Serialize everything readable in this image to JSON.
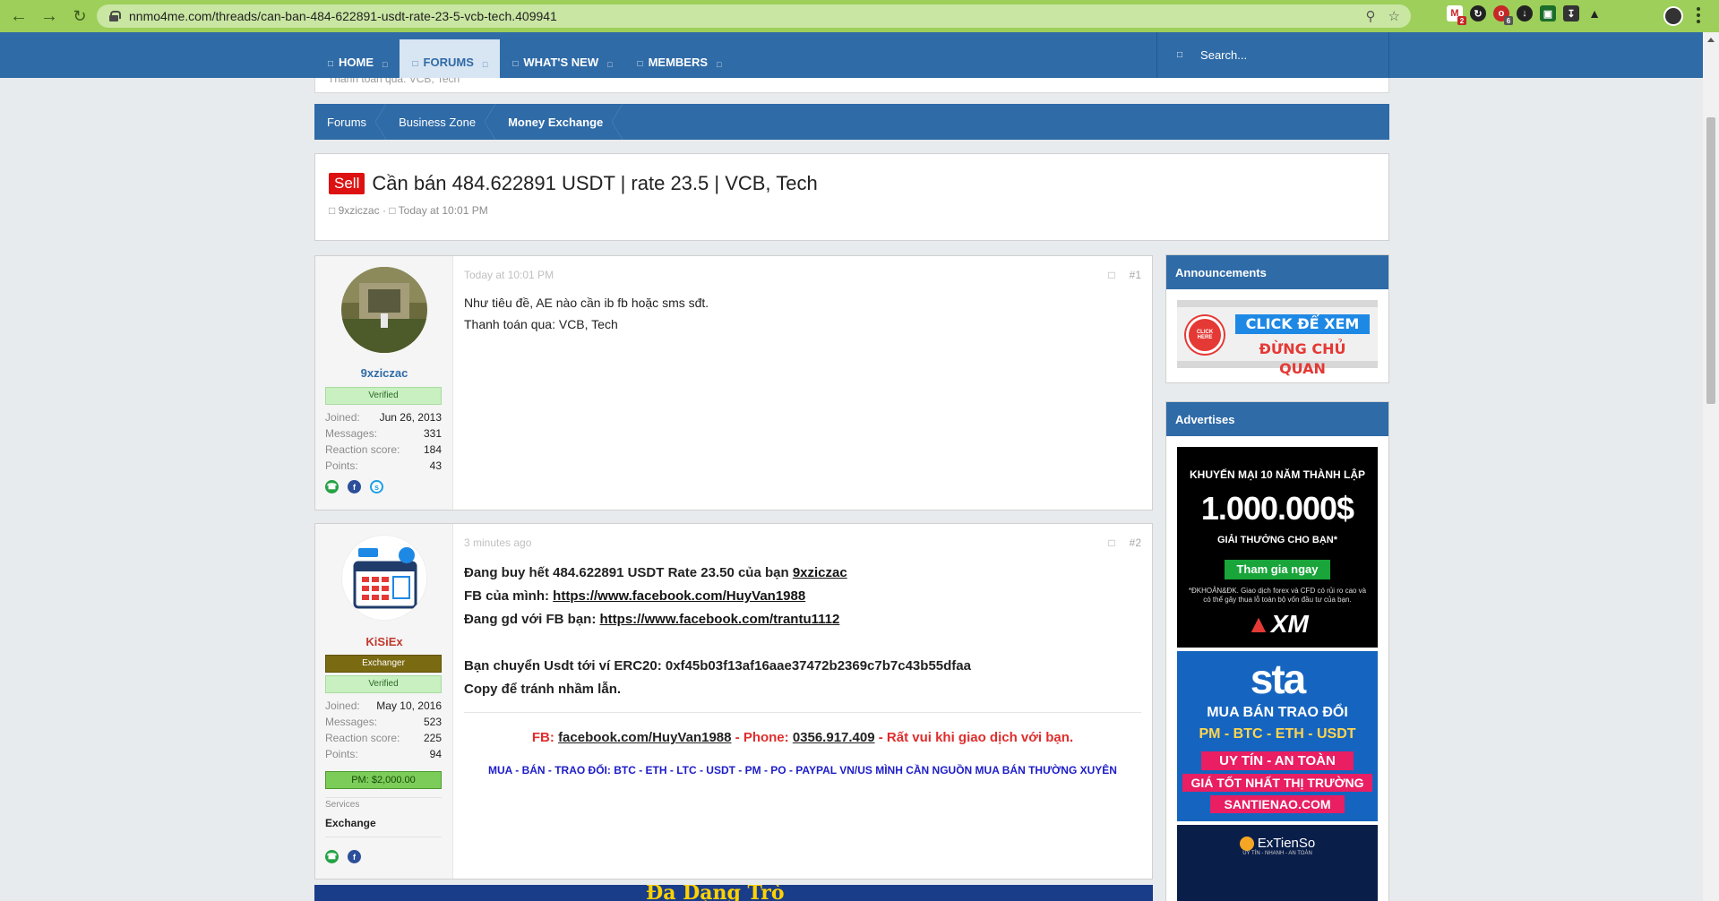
{
  "browser": {
    "url": "nnmo4me.com/threads/can-ban-484-622891-usdt-rate-23-5-vcb-tech.409941",
    "ext_badges": [
      "2",
      "6"
    ]
  },
  "nav": {
    "tabs": [
      {
        "label": "HOME"
      },
      {
        "label": "FORUMS"
      },
      {
        "label": "WHAT'S NEW"
      },
      {
        "label": "MEMBERS"
      }
    ],
    "search_placeholder": "Search..."
  },
  "prev_text": "Thanh toán qua: VCB, Tech",
  "breadcrumb": [
    "Forums",
    "Business Zone",
    "Money Exchange"
  ],
  "thread": {
    "badge": "Sell",
    "title": "Cần bán 484.622891 USDT | rate 23.5 | VCB, Tech",
    "author": "9xziczac",
    "date": "Today at 10:01 PM"
  },
  "posts": [
    {
      "username": "9xziczac",
      "badges": [
        "Verified"
      ],
      "stats": [
        {
          "label": "Joined:",
          "value": "Jun 26, 2013"
        },
        {
          "label": "Messages:",
          "value": "331"
        },
        {
          "label": "Reaction score:",
          "value": "184"
        },
        {
          "label": "Points:",
          "value": "43"
        }
      ],
      "date": "Today at 10:01 PM",
      "num": "#1",
      "lines": [
        "Như tiêu đề, AE nào cần ib fb hoặc sms sđt.",
        "Thanh toán qua: VCB, Tech"
      ]
    },
    {
      "username": "KiSiEx",
      "badges": [
        "Exchanger",
        "Verified"
      ],
      "stats": [
        {
          "label": "Joined:",
          "value": "May 10, 2016"
        },
        {
          "label": "Messages:",
          "value": "523"
        },
        {
          "label": "Reaction score:",
          "value": "225"
        },
        {
          "label": "Points:",
          "value": "94"
        }
      ],
      "pm_badge": "PM: $2,000.00",
      "services_label": "Services",
      "services_value": "Exchange",
      "date": "3 minutes ago",
      "num": "#2",
      "line1_pre": "Đang buy hết 484.622891 USDT Rate 23.50 của bạn ",
      "line1_link": "9xziczac",
      "line2_pre": "FB của mình: ",
      "line2_link": "https://www.facebook.com/HuyVan1988",
      "line3_pre": "Đang gd với FB bạn: ",
      "line3_link": "https://www.facebook.com/trantu1112",
      "line4": "Bạn chuyển Usdt tới ví ERC20: 0xf45b03f13af16aae37472b2369c7b7c43b55dfaa",
      "line5": "Copy để tránh nhầm lẫn.",
      "sig_fb_label": "FB: ",
      "sig_fb_link": "facebook.com/HuyVan1988",
      "sig_phone_label": " - Phone: ",
      "sig_phone": "0356.917.409",
      "sig_tail": " - Rất vui khi giao dịch với bạn.",
      "sig_line2": "MUA - BÁN - TRAO ĐỔI: BTC - ETH - LTC - USDT - PM - PO - PAYPAL VN/US MÌNH CẦN NGUỒN MUA BÁN THƯỜNG XUYÊN"
    }
  ],
  "sidebar": {
    "announcements_title": "Announcements",
    "announce_ad": {
      "line1": "CLICK ĐỂ XEM",
      "line2": "ĐỪNG CHỦ QUAN",
      "btn": "CLICK HERE"
    },
    "advertises_title": "Advertises",
    "ad_xm": {
      "line1": "KHUYẾN MẠI 10 NĂM THÀNH LẬP",
      "amount": "1.000.000$",
      "line2": "GIẢI THƯỞNG CHO BẠN*",
      "cta": "Tham gia ngay",
      "disclaimer": "*ĐKHOẢN&ĐK. Giao dịch forex và CFD có rủi ro cao và có thể gây thua lỗ toàn bộ vốn đầu tư của bạn.",
      "brand": "XM"
    },
    "ad_sta": {
      "brand": "sta",
      "line1": "MUA BÁN TRAO ĐỔI",
      "line2": "PM - BTC - ETH - USDT",
      "line3": "UY TÍN - AN TOÀN",
      "line4": "GIÁ TỐT NHẤT THỊ TRƯỜNG",
      "line5": "SANTIENAO.COM"
    },
    "ad_extienso": {
      "brand": "ExTienSo",
      "tagline": "UY TÍN - NHANH - AN TOÀN"
    }
  },
  "bottom_banner": "Đa Dạng Trò"
}
